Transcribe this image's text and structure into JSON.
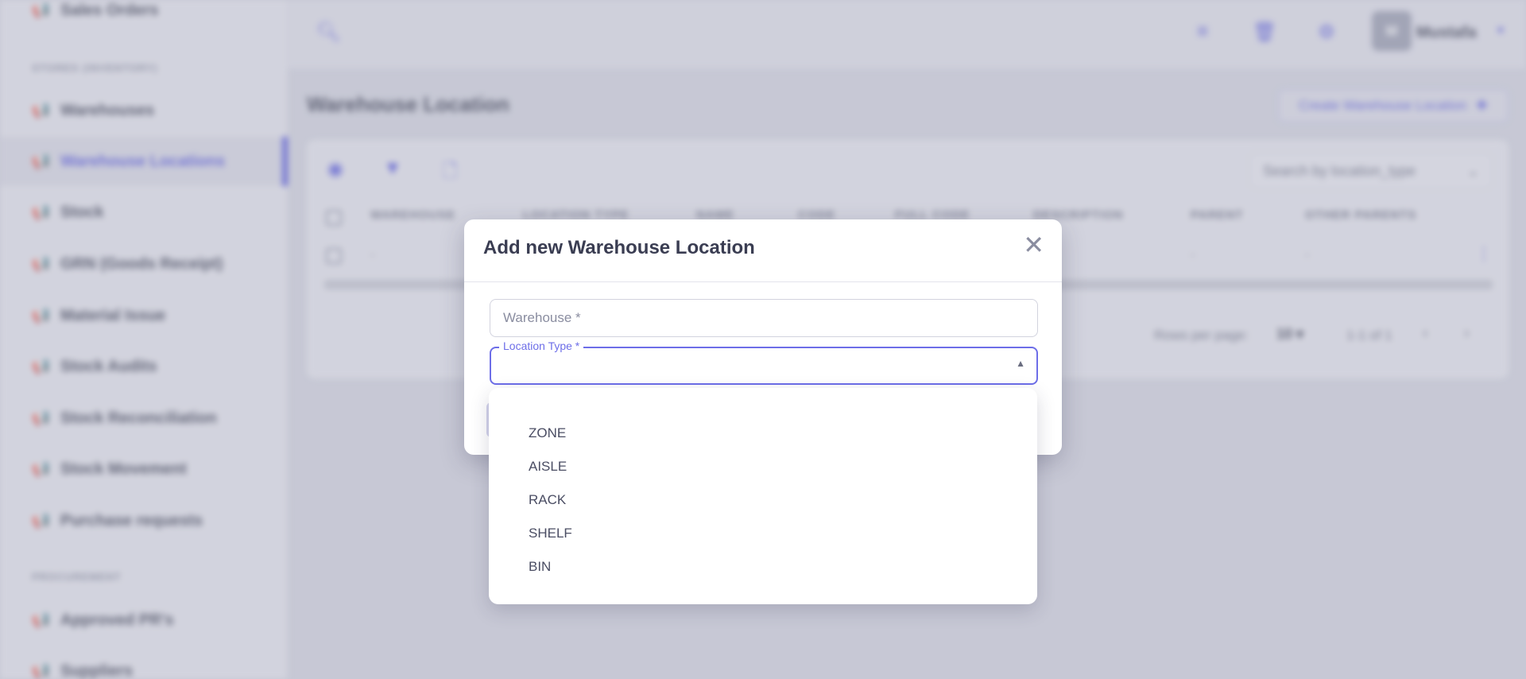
{
  "sidebar": {
    "items": [
      {
        "label": "Sales Orders"
      },
      {
        "label": "Warehouses"
      },
      {
        "label": "Warehouse Locations",
        "active": true
      },
      {
        "label": "Stock"
      },
      {
        "label": "GRN (Goods Receipt)"
      },
      {
        "label": "Material Issue"
      },
      {
        "label": "Stock Audits"
      },
      {
        "label": "Stock Reconciliation"
      },
      {
        "label": "Stock Movement"
      },
      {
        "label": "Purchase requests"
      },
      {
        "label": "Approved PR's"
      },
      {
        "label": "Suppliers"
      }
    ],
    "sections": [
      "STORES (INVENTORY)",
      "PROCUREMENT"
    ],
    "item_icon": "megaphone-icon"
  },
  "topbar": {
    "search_icon": "search-icon",
    "icons": [
      "sitemap-icon",
      "trash-icon",
      "gear-icon"
    ],
    "user": {
      "initials": "M",
      "name": "Mustafa"
    }
  },
  "page": {
    "title": "Warehouse Location",
    "create_button": "Create Warehouse Location",
    "create_icon": "plus-icon"
  },
  "table": {
    "toolbar_icons": [
      "eye-icon",
      "filter-icon",
      "document-icon"
    ],
    "search_placeholder": "Search by location_type",
    "columns": [
      "WAREHOUSE",
      "LOCATION TYPE",
      "NAME",
      "CODE",
      "FULL CODE",
      "DESCRIPTION",
      "PARENT",
      "OTHER PARENTS"
    ],
    "rows": [
      [
        "-",
        "",
        "",
        "",
        "",
        "",
        "-",
        "-"
      ]
    ],
    "pagination": {
      "rows_per_page_label": "Rows per page:",
      "rows_per_page": "10",
      "range": "1-1 of 1"
    }
  },
  "modal": {
    "title": "Add new Warehouse Location",
    "warehouse_placeholder": "Warehouse *",
    "location_type_label": "Location Type *",
    "location_type_options": [
      "ZONE",
      "AISLE",
      "RACK",
      "SHELF",
      "BIN"
    ]
  },
  "colors": {
    "accent": "#6d6ee8",
    "text": "#3a3d52"
  }
}
